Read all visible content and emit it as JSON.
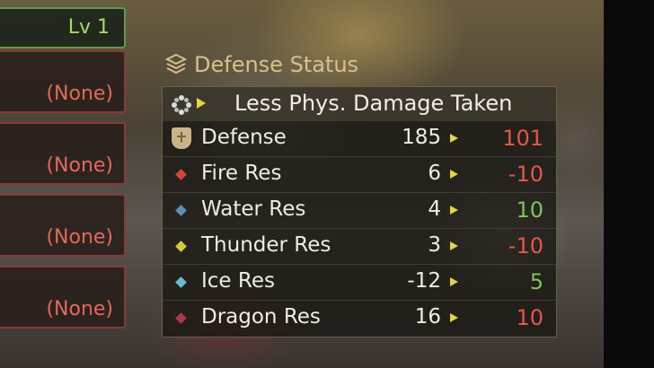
{
  "left_slots": {
    "level_label": "Lv 1",
    "items": [
      {
        "label": "(None)"
      },
      {
        "label": "(None)"
      },
      {
        "label": "(None)"
      },
      {
        "label": "(None)"
      }
    ]
  },
  "defense_panel": {
    "title": "Defense Status",
    "title_icon": "defense-status-icon",
    "header": {
      "icon": "skill-decoration-icon",
      "text": "Less Phys. Damage Taken"
    },
    "rows": [
      {
        "icon": "shield-icon",
        "icon_color": "#c9b48a",
        "label": "Defense",
        "base": "185",
        "new": "101",
        "new_color": "#e0584a"
      },
      {
        "icon": "fire-icon",
        "icon_color": "#d4463c",
        "label": "Fire Res",
        "base": "6",
        "new": "-10",
        "new_color": "#e0584a"
      },
      {
        "icon": "water-icon",
        "icon_color": "#5a8cb4",
        "label": "Water Res",
        "base": "4",
        "new": "10",
        "new_color": "#7cc45a"
      },
      {
        "icon": "thunder-icon",
        "icon_color": "#d4c83c",
        "label": "Thunder Res",
        "base": "3",
        "new": "-10",
        "new_color": "#e0584a"
      },
      {
        "icon": "ice-icon",
        "icon_color": "#6ab8d4",
        "label": "Ice Res",
        "base": "-12",
        "new": "5",
        "new_color": "#7cc45a"
      },
      {
        "icon": "dragon-icon",
        "icon_color": "#a43a4c",
        "label": "Dragon Res",
        "base": "16",
        "new": "10",
        "new_color": "#e0584a"
      }
    ]
  },
  "colors": {
    "title_gold": "#d9c08a",
    "arrow_yellow": "#e8d24a",
    "slot_border_red": "#8a3a34",
    "slot_text_red": "#e06a5c",
    "level_green": "#a8d86e"
  }
}
